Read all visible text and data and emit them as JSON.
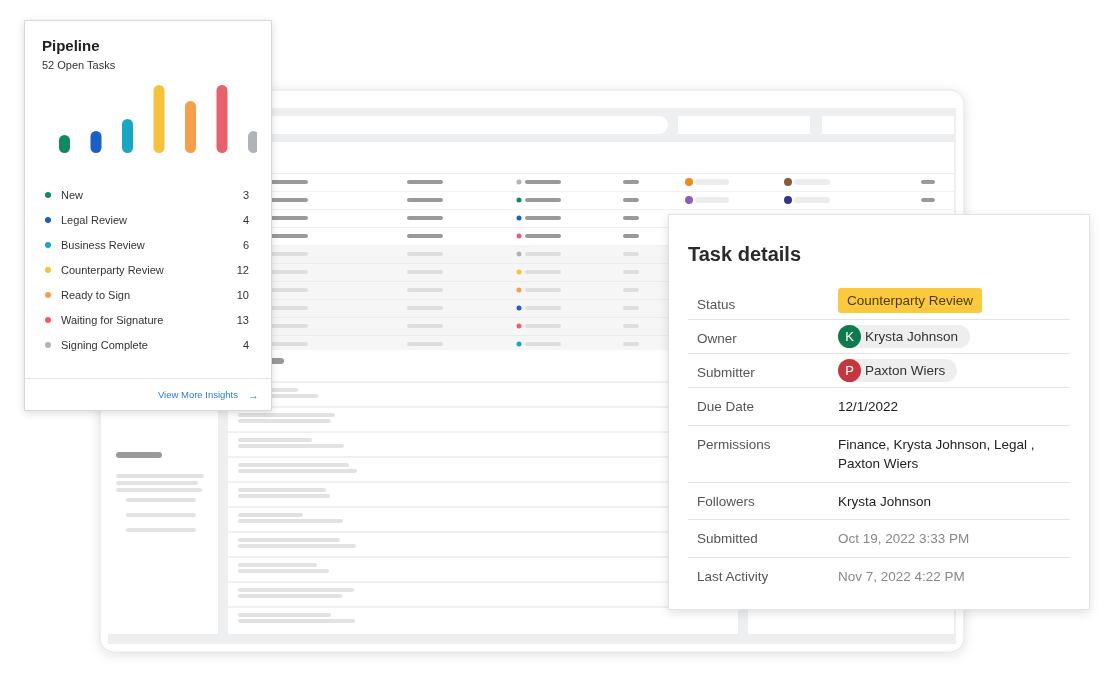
{
  "pipeline": {
    "title": "Pipeline",
    "subtitle": "52 Open Tasks",
    "legend": [
      {
        "label": "New",
        "count": "3",
        "color": "#0f8a5f"
      },
      {
        "label": "Legal Review",
        "count": "4",
        "color": "#1a5fc8"
      },
      {
        "label": "Business Review",
        "count": "6",
        "color": "#17a6c4"
      },
      {
        "label": "Counterparty Review",
        "count": "12",
        "color": "#f7c23b"
      },
      {
        "label": "Ready to Sign",
        "count": "10",
        "color": "#f59e4c"
      },
      {
        "label": "Waiting for Signature",
        "count": "13",
        "color": "#e8616a"
      },
      {
        "label": "Signing Complete",
        "count": "4",
        "color": "#b0b3b8"
      }
    ],
    "link": "View More Insights",
    "link_arrow": "→"
  },
  "task_details": {
    "title": "Task details",
    "fields": [
      {
        "label": "Status",
        "kind": "badge",
        "value": "Counterparty Review"
      },
      {
        "label": "Owner",
        "kind": "person",
        "initial": "K",
        "value": "Krysta Johnson",
        "color": "#0f7a4c"
      },
      {
        "label": "Submitter",
        "kind": "person",
        "initial": "P",
        "value": "Paxton Wiers",
        "color": "#c4373f"
      },
      {
        "label": "Due Date",
        "kind": "text",
        "value": "12/1/2022"
      },
      {
        "label": "Permissions",
        "kind": "text",
        "value": "Finance, Krysta Johnson, Legal , Paxton Wiers"
      },
      {
        "label": "Followers",
        "kind": "text",
        "value": "Krysta Johnson"
      },
      {
        "label": "Submitted",
        "kind": "muted",
        "value": "Oct 19, 2022 3:33 PM"
      },
      {
        "label": "Last Activity",
        "kind": "muted",
        "value": "Nov 7, 2022 4:22 PM"
      }
    ]
  }
}
